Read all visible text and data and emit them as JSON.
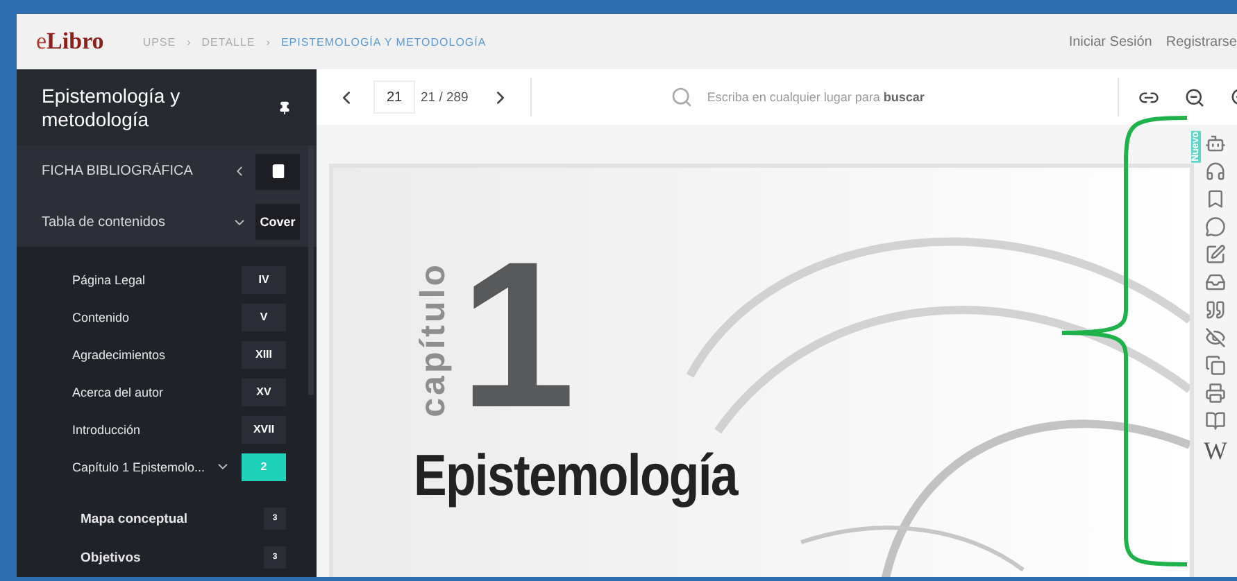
{
  "header": {
    "logo": "e**Libro**",
    "breadcrumbs": [
      {
        "label": "UPSE",
        "current": false
      },
      {
        "separator": "›",
        "label": "DETALLE",
        "current": false
      },
      {
        "separator": "›",
        "label": "EPISTEMOLOGÍA Y METODOLOGÍA",
        "current": true
      }
    ],
    "links": [
      "Iniciar Sesión",
      "Registrarse"
    ]
  },
  "sidebar": {
    "title": "Epistemología y metodología",
    "sections": [
      {
        "label": "FICHA BIBLIOGRÁFICA",
        "expanded": false,
        "kind": "icon"
      },
      {
        "label": "Tabla de contenidos",
        "expanded": true,
        "kind": "text",
        "button": "Cover"
      }
    ],
    "toc": [
      {
        "label": "Página Legal",
        "page": "IV",
        "selected": false
      },
      {
        "label": "Contenido",
        "page": "V",
        "selected": false
      },
      {
        "label": "Agradecimientos",
        "page": "XIII",
        "selected": false
      },
      {
        "label": "Acerca del autor",
        "page": "XV",
        "selected": false
      },
      {
        "label": "Introducción",
        "page": "XVII",
        "selected": false
      },
      {
        "label": "Capítulo 1 Epistemolo...",
        "page": "2",
        "selected": true,
        "expanded": true,
        "children": [
          {
            "label": "Mapa conceptual",
            "page": "3",
            "selected": false
          },
          {
            "label": "Objetivos",
            "page": "3",
            "selected": false
          }
        ]
      }
    ]
  },
  "toolbar": {
    "page_input": "21",
    "page_count": "21 / 289",
    "search_placeholder": "Escriba en cualquier lugar para **buscar**"
  },
  "page": {
    "label": "capítulo",
    "number": "1",
    "title": "Epistemología"
  },
  "tools": {
    "badge": "Nuevo",
    "wiki": "W"
  }
}
